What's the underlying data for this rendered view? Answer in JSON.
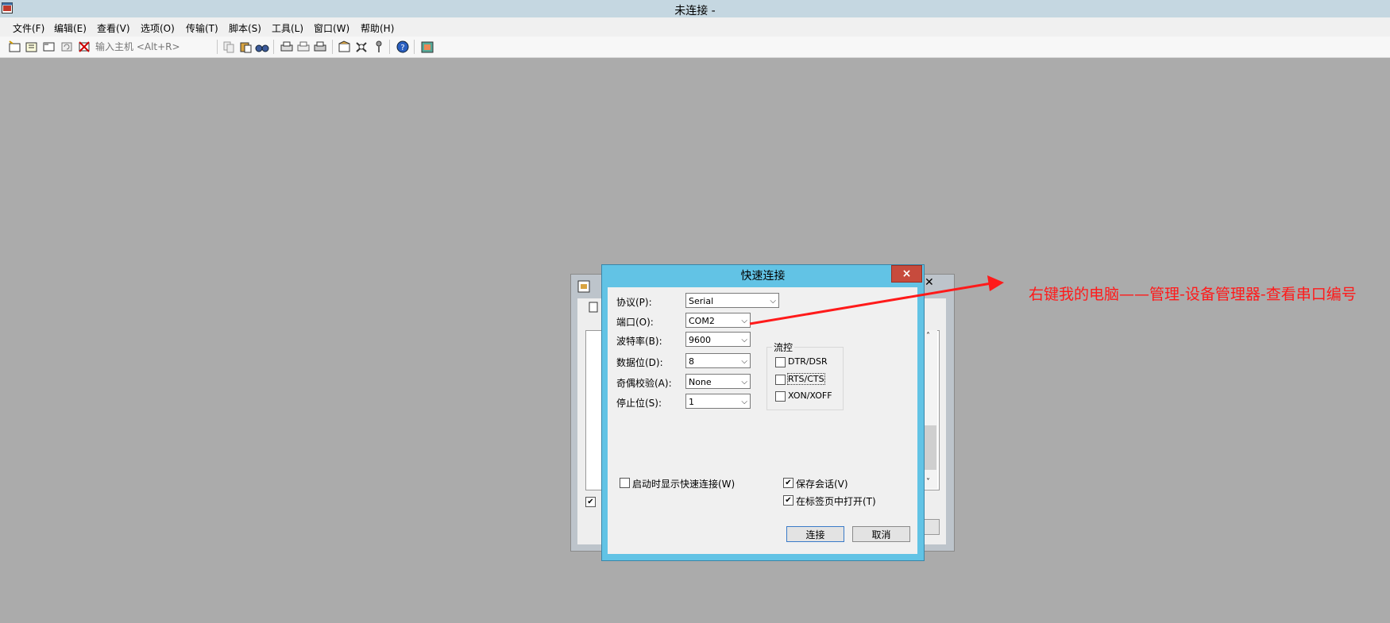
{
  "window": {
    "title": "未连接 -"
  },
  "menu": {
    "items": [
      "文件(F)",
      "编辑(E)",
      "查看(V)",
      "选项(O)",
      "传输(T)",
      "脚本(S)",
      "工具(L)",
      "窗口(W)",
      "帮助(H)"
    ]
  },
  "toolbar": {
    "host_placeholder": "输入主机 <Alt+R>"
  },
  "dialog": {
    "title": "快速连接",
    "close_label": "×",
    "protocol_label": "协议(P):",
    "protocol_value": "Serial",
    "port_label": "端口(O):",
    "port_value": "COM2",
    "baud_label": "波特率(B):",
    "baud_value": "9600",
    "databits_label": "数据位(D):",
    "databits_value": "8",
    "parity_label": "奇偶校验(A):",
    "parity_value": "None",
    "stopbits_label": "停止位(S):",
    "stopbits_value": "1",
    "flow_label": "流控",
    "flow_options": [
      {
        "label": "DTR/DSR",
        "checked": false
      },
      {
        "label": "RTS/CTS",
        "checked": false
      },
      {
        "label": "XON/XOFF",
        "checked": false
      }
    ],
    "show_on_startup_label": "启动时显示快速连接(W)",
    "show_on_startup_checked": false,
    "save_session_label": "保存会话(V)",
    "save_session_checked": true,
    "open_in_tab_label": "在标签页中打开(T)",
    "open_in_tab_checked": true,
    "connect_label": "连接",
    "cancel_label": "取消"
  },
  "annotation": {
    "text": "右键我的电脑——管理-设备管理器-查看串口编号",
    "color": "#ff1a1a"
  }
}
